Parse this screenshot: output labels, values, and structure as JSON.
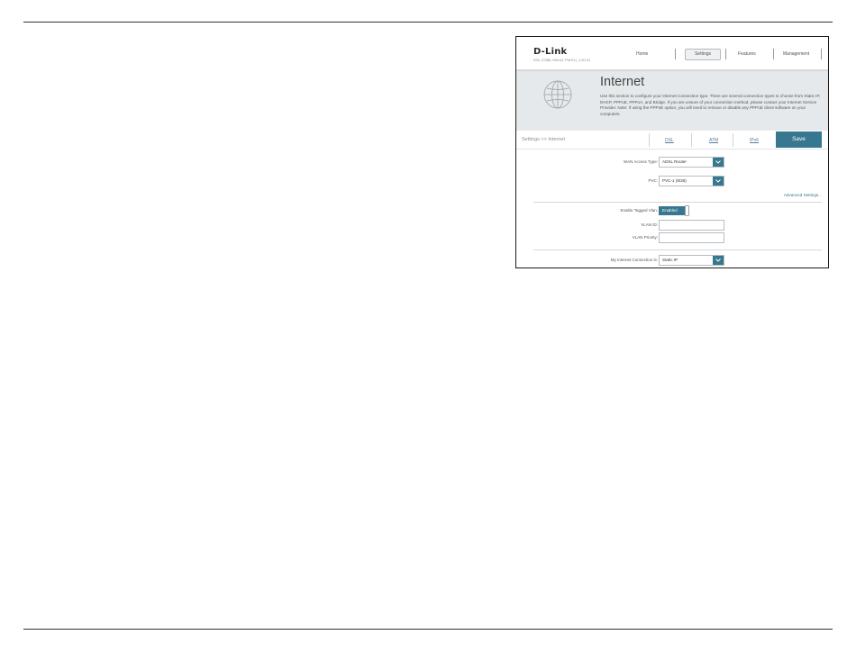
{
  "header": {
    "logo": "D-Link",
    "model": "DSL-3788L   HW:A1   FW:EU_1.00.01",
    "nav": {
      "home": "Home",
      "settings": "Settings",
      "features": "Features",
      "management": "Management"
    }
  },
  "banner": {
    "title": "Internet",
    "description": "Use this section to configure your Internet Connection type. There are several connection types to choose from Static IP, DHCP, PPPoE, PPPoA, and Bridge. If you are unsure of your connection method, please contact your Internet Service Provider. Note: If using the PPPoE option, you will need to remove or disable any PPPoE client software on your computers."
  },
  "tabbar": {
    "breadcrumb": "Settings >> Internet",
    "tabs": {
      "dsl": "DSL",
      "atm": "ATM",
      "ipv6": "IPv6"
    },
    "save": "Save"
  },
  "form": {
    "wan_access_type": {
      "label": "WAN Access Type:",
      "value": "ADSL Router"
    },
    "pvc": {
      "label": "PVC:",
      "value": "PVC-1 (8/35)"
    },
    "advanced_link": "Advanced Settings...",
    "tagged_vlan": {
      "label": "Enable Tagged Vlan:",
      "value": "Enabled"
    },
    "vlan_id": {
      "label": "VLAN ID:",
      "value": ""
    },
    "vlan_priority": {
      "label": "VLAN Priority:",
      "value": ""
    },
    "connection": {
      "label": "My Internet Connection is:",
      "value": "Static IP"
    }
  },
  "colors": {
    "accent": "#37778f",
    "banner_bg": "#e6e9eb"
  },
  "icons": {
    "globe": "globe-icon",
    "dropdown": "chevron-down-icon"
  }
}
